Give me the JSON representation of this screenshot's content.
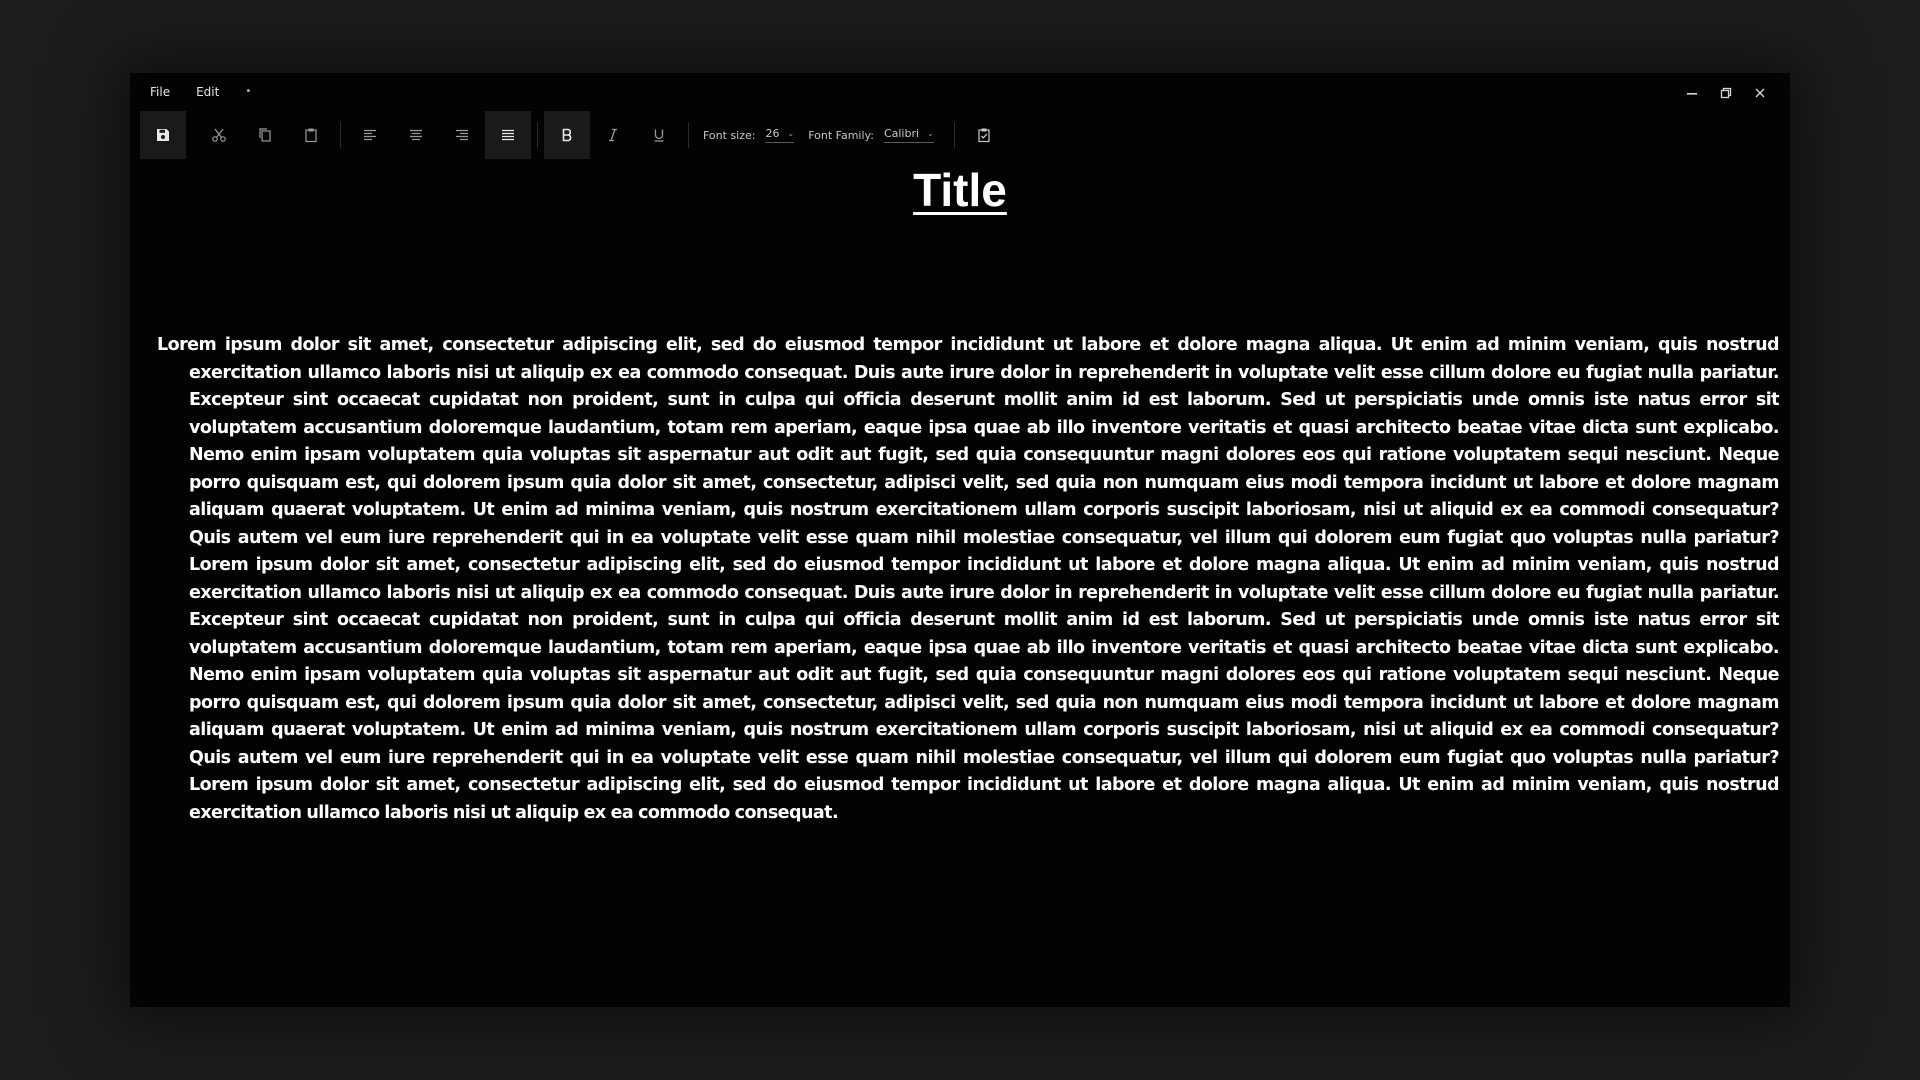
{
  "menu": {
    "file_label": "File",
    "edit_label": "Edit",
    "extra_label": "•"
  },
  "toolbar": {
    "font_size_label": "Font size:",
    "font_size_value": "26",
    "font_family_label": "Font Family:",
    "font_family_value": "Calibri",
    "active_alignment": "justify",
    "bold_active": true
  },
  "document": {
    "title": "Title",
    "body": "Lorem ipsum dolor sit amet, consectetur adipiscing elit, sed do eiusmod tempor incididunt ut labore et dolore magna aliqua. Ut enim ad minim veniam, quis nostrud exercitation ullamco laboris nisi ut aliquip ex ea commodo consequat. Duis aute irure dolor in reprehenderit in voluptate velit esse cillum dolore eu fugiat nulla pariatur. Excepteur sint occaecat cupidatat non proident, sunt in culpa qui officia deserunt mollit anim id est laborum. Sed ut perspiciatis unde omnis iste natus error sit voluptatem accusantium doloremque laudantium, totam rem aperiam, eaque ipsa quae ab illo inventore veritatis et quasi architecto beatae vitae dicta sunt explicabo. Nemo enim ipsam voluptatem quia voluptas sit aspernatur aut odit aut fugit, sed quia consequuntur magni dolores eos qui ratione voluptatem sequi nesciunt. Neque porro quisquam est, qui dolorem ipsum quia dolor sit amet, consectetur, adipisci velit, sed quia non numquam eius modi tempora incidunt ut labore et dolore magnam aliquam quaerat voluptatem. Ut enim ad minima veniam, quis nostrum exercitationem ullam corporis suscipit laboriosam, nisi ut aliquid ex ea commodi consequatur? Quis autem vel eum iure reprehenderit qui in ea voluptate velit esse quam nihil molestiae consequatur, vel illum qui dolorem eum fugiat quo voluptas nulla pariatur? Lorem ipsum dolor sit amet, consectetur adipiscing elit, sed do eiusmod tempor incididunt ut labore et dolore magna aliqua. Ut enim ad minim veniam, quis nostrud exercitation ullamco laboris nisi ut aliquip ex ea commodo consequat. Duis aute irure dolor in reprehenderit in voluptate velit esse cillum dolore eu fugiat nulla pariatur. Excepteur sint occaecat cupidatat non proident, sunt in culpa qui officia deserunt mollit anim id est laborum. Sed ut perspiciatis unde omnis iste natus error sit voluptatem accusantium doloremque laudantium, totam rem aperiam, eaque ipsa quae ab illo inventore veritatis et quasi architecto beatae vitae dicta sunt explicabo. Nemo enim ipsam voluptatem quia voluptas sit aspernatur aut odit aut fugit, sed quia consequuntur magni dolores eos qui ratione voluptatem sequi nesciunt. Neque porro quisquam est, qui dolorem ipsum quia dolor sit amet, consectetur, adipisci velit, sed quia non numquam eius modi tempora incidunt ut labore et dolore magnam aliquam quaerat voluptatem. Ut enim ad minima veniam, quis nostrum exercitationem ullam corporis suscipit laboriosam, nisi ut aliquid ex ea commodi consequatur? Quis autem vel eum iure reprehenderit qui in ea voluptate velit esse quam nihil molestiae consequatur, vel illum qui dolorem eum fugiat quo voluptas nulla pariatur? Lorem ipsum dolor sit amet, consectetur adipiscing elit, sed do eiusmod tempor incididunt ut labore et dolore magna aliqua. Ut enim ad minim veniam, quis nostrud exercitation ullamco laboris nisi ut aliquip ex ea commodo consequat."
  },
  "colors": {
    "page_background": "#1c1c1c",
    "window_background": "#030303",
    "text": "#ffffff",
    "active_button_background": "#1a1a1a"
  }
}
